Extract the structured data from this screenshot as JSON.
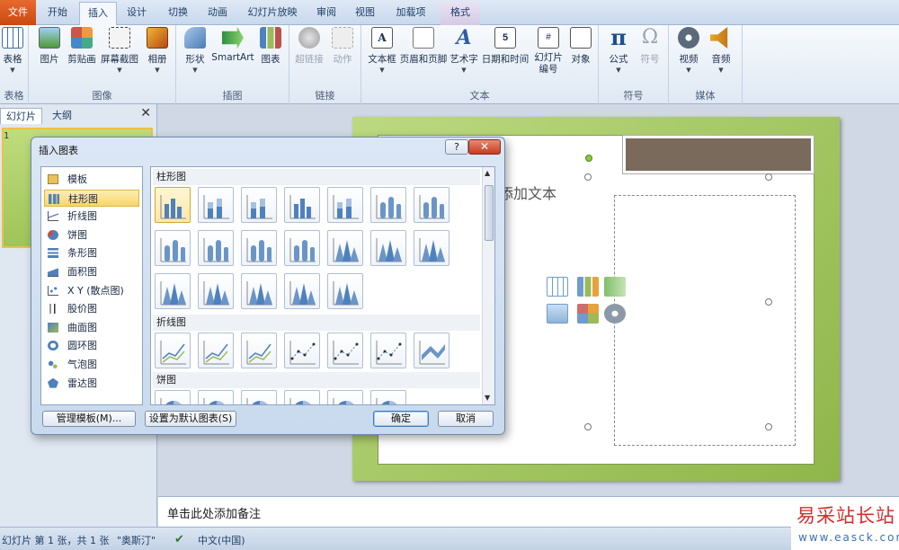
{
  "ribbon": {
    "tabs": [
      "文件",
      "开始",
      "插入",
      "设计",
      "切换",
      "动画",
      "幻灯片放映",
      "审阅",
      "视图",
      "加载项",
      "格式"
    ],
    "groups": {
      "tables": {
        "label": "表格",
        "buttons": [
          "表格"
        ]
      },
      "images": {
        "label": "图像",
        "buttons": [
          "图片",
          "剪贴画",
          "屏幕截图",
          "相册"
        ]
      },
      "illustrations": {
        "label": "插图",
        "buttons": [
          "形状",
          "SmartArt",
          "图表"
        ]
      },
      "links": {
        "label": "链接",
        "buttons": [
          "超链接",
          "动作"
        ]
      },
      "text": {
        "label": "文本",
        "buttons": [
          "文本框",
          "页眉和页脚",
          "艺术字",
          "日期和时间",
          "幻灯片\n编号",
          "对象"
        ]
      },
      "symbols": {
        "label": "符号",
        "buttons": [
          "公式",
          "符号"
        ]
      },
      "media": {
        "label": "媒体",
        "buttons": [
          "视频",
          "音频"
        ]
      }
    }
  },
  "leftpane": {
    "tabs": [
      "幻灯片",
      "大纲"
    ],
    "close": "✕",
    "slide_number": "1"
  },
  "slide": {
    "placeholder_text": "添加文本"
  },
  "notes": {
    "placeholder": "单击此处添加备注"
  },
  "statusbar": {
    "slide_info": "幻灯片 第 1 张，共 1 张",
    "theme": "\"奥斯汀\"",
    "language": "中文(中国)"
  },
  "watermark": {
    "line1": "易采站长站",
    "line2": "www.easck.com"
  },
  "dialog": {
    "title": "插入图表",
    "help": "?",
    "close": "✕",
    "categories": [
      "模板",
      "柱形图",
      "折线图",
      "饼图",
      "条形图",
      "面积图",
      "X Y (散点图)",
      "股价图",
      "曲面图",
      "圆环图",
      "气泡图",
      "雷达图"
    ],
    "selected_category": "柱形图",
    "sections": [
      "柱形图",
      "折线图",
      "饼图"
    ],
    "buttons": {
      "manage": "管理模板(M)...",
      "set_default": "设置为默认图表(S)",
      "ok": "确定",
      "cancel": "取消"
    }
  },
  "colors": {
    "accent_orange": "#c94a12",
    "selection_gold": "#f8d66a",
    "slide_green": "#9fc459",
    "chart_blue": "#4f81bd"
  }
}
